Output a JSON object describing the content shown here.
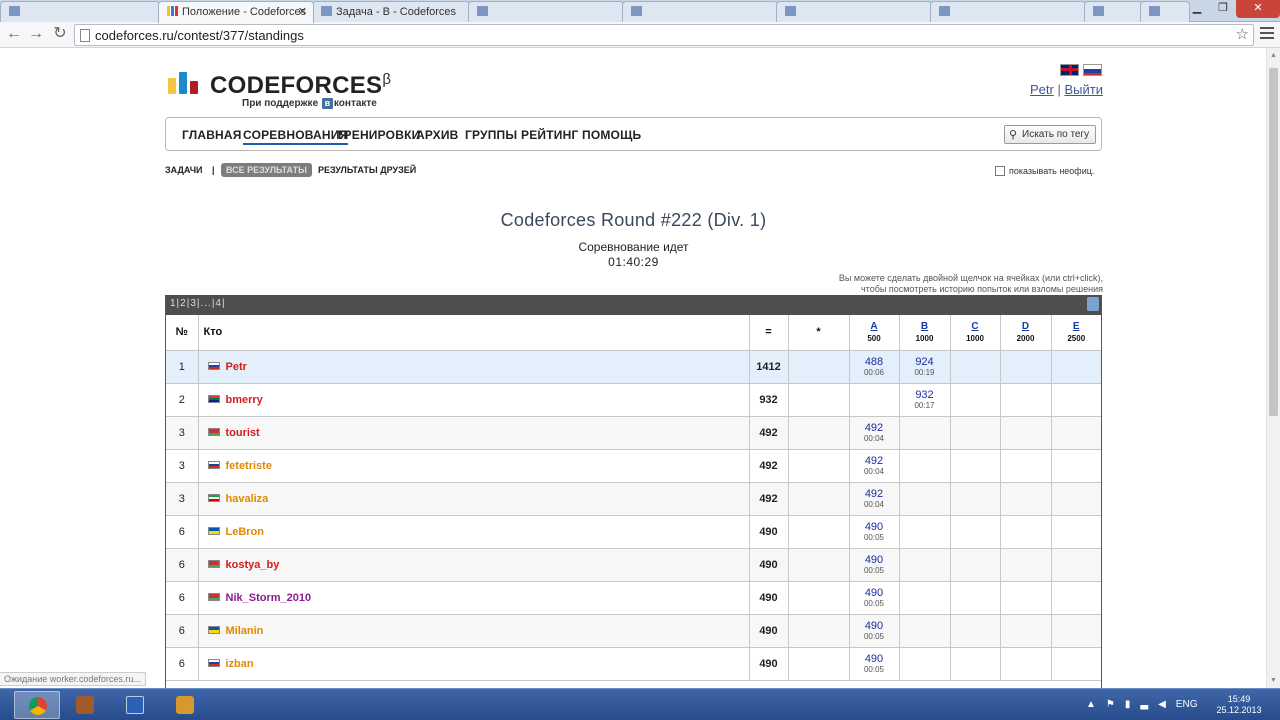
{
  "browser": {
    "tabs": [
      {
        "title": "",
        "active": false
      },
      {
        "title": "Положение - Codeforces",
        "active": true
      },
      {
        "title": "Задача - B - Codeforces",
        "active": false
      },
      {
        "title": "",
        "active": false
      },
      {
        "title": "",
        "active": false
      },
      {
        "title": "",
        "active": false
      },
      {
        "title": "",
        "active": false
      },
      {
        "title": "",
        "active": false
      },
      {
        "title": "",
        "active": false
      }
    ],
    "close_glyph": "✕",
    "url": "codeforces.ru/contest/377/standings"
  },
  "site": {
    "logo_word": "CODEFORCES",
    "logo_beta": "β",
    "tagline_pre": "При поддержке",
    "tagline_vk": "в",
    "tagline_post": "контакте",
    "user": "Petr",
    "sep": "|",
    "logout": "Выйти",
    "menu": [
      "ГЛАВНАЯ",
      "СОРЕВНОВАНИЯ",
      "ТРЕНИРОВКИ",
      "АРХИВ",
      "ГРУППЫ",
      "РЕЙТИНГ",
      "ПОМОЩЬ"
    ],
    "search_tag": "Искать по тегу"
  },
  "contest": {
    "tabs": [
      "ЗАДАЧИ",
      "|",
      "ВСЕ РЕЗУЛЬТАТЫ",
      "РЕЗУЛЬТАТЫ ДРУЗЕЙ"
    ],
    "unofficial": "показывать неофиц.",
    "title": "Codeforces Round #222 (Div. 1)",
    "status": "Соревнование идет",
    "timer": "01:40:29",
    "hint_line1": "Вы можете сделать двойной щелчок на ячейках (или ctrl+click),",
    "hint_line2": "чтобы посмотреть историю попыток или взломы решения",
    "pager": "1|2|3|...|4|"
  },
  "table": {
    "headers": {
      "rank": "№",
      "who": "Кто",
      "eq": "=",
      "star": "*"
    },
    "problems": [
      {
        "letter": "A",
        "points": "500"
      },
      {
        "letter": "B",
        "points": "1000"
      },
      {
        "letter": "C",
        "points": "1000"
      },
      {
        "letter": "D",
        "points": "2000"
      },
      {
        "letter": "E",
        "points": "2500"
      }
    ],
    "rows": [
      {
        "rank": "1",
        "handle": "Petr",
        "color": "red",
        "flag": "ru",
        "points": "1412",
        "a": {
          "p": "488",
          "t": "00:06"
        },
        "b": {
          "p": "924",
          "t": "00:19"
        }
      },
      {
        "rank": "2",
        "handle": "bmerry",
        "color": "red",
        "flag": "za",
        "points": "932",
        "a": null,
        "b": {
          "p": "932",
          "t": "00:17"
        }
      },
      {
        "rank": "3",
        "handle": "tourist",
        "color": "red",
        "flag": "by",
        "points": "492",
        "a": {
          "p": "492",
          "t": "00:04"
        },
        "b": null
      },
      {
        "rank": "3",
        "handle": "fetetriste",
        "color": "orange",
        "flag": "ru",
        "points": "492",
        "a": {
          "p": "492",
          "t": "00:04"
        },
        "b": null
      },
      {
        "rank": "3",
        "handle": "havaliza",
        "color": "orange",
        "flag": "ir",
        "points": "492",
        "a": {
          "p": "492",
          "t": "00:04"
        },
        "b": null
      },
      {
        "rank": "6",
        "handle": "LeBron",
        "color": "orange",
        "flag": "ua",
        "points": "490",
        "a": {
          "p": "490",
          "t": "00:05"
        },
        "b": null
      },
      {
        "rank": "6",
        "handle": "kostya_by",
        "color": "red",
        "flag": "by",
        "points": "490",
        "a": {
          "p": "490",
          "t": "00:05"
        },
        "b": null
      },
      {
        "rank": "6",
        "handle": "Nik_Storm_2010",
        "color": "violet",
        "flag": "by",
        "points": "490",
        "a": {
          "p": "490",
          "t": "00:05"
        },
        "b": null
      },
      {
        "rank": "6",
        "handle": "Milanin",
        "color": "orange",
        "flag": "ua",
        "points": "490",
        "a": {
          "p": "490",
          "t": "00:05"
        },
        "b": null
      },
      {
        "rank": "6",
        "handle": "izban",
        "color": "orange",
        "flag": "ru",
        "points": "490",
        "a": {
          "p": "490",
          "t": "00:05"
        },
        "b": null
      }
    ]
  },
  "statusbar": "Ожидание worker.codeforces.ru...",
  "taskbar": {
    "lang": "ENG",
    "time": "15:49",
    "date": "25.12.2013"
  },
  "colors": {
    "accent": "#1a61b4",
    "handle_red": "#d31d1d",
    "handle_orange": "#e08a00",
    "handle_violet": "#8a1d8a"
  }
}
